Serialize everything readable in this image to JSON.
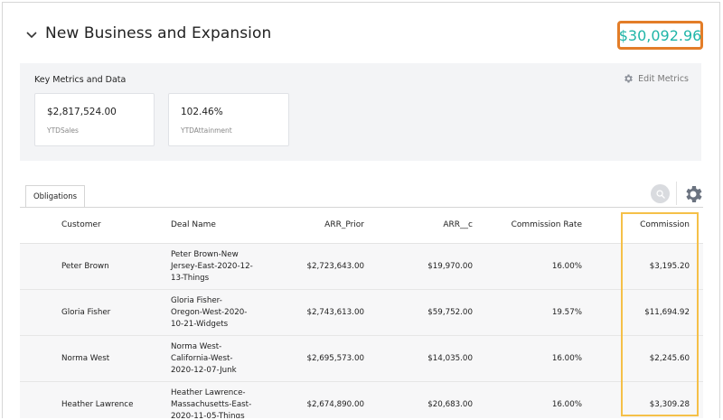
{
  "header": {
    "title": "New Business and Expansion",
    "amount": "$30,092.96"
  },
  "metrics": {
    "title": "Key Metrics and Data",
    "edit_label": "Edit Metrics",
    "cards": [
      {
        "value": "$2,817,524.00",
        "label": "YTDSales"
      },
      {
        "value": "102.46%",
        "label": "YTDAttainment"
      }
    ]
  },
  "tabs": [
    {
      "label": "Obligations"
    }
  ],
  "table": {
    "columns": [
      "Customer",
      "Deal Name",
      "ARR_Prior",
      "ARR__c",
      "Commission Rate",
      "Commission"
    ],
    "rows": [
      {
        "customer": "Peter Brown",
        "deal_lines": [
          "Peter Brown-New",
          "Jersey-East-2020-12-",
          "13-Things"
        ],
        "arr_prior": "$2,723,643.00",
        "arr_c": "$19,970.00",
        "rate": "16.00%",
        "commission": "$3,195.20"
      },
      {
        "customer": "Gloria Fisher",
        "deal_lines": [
          "Gloria Fisher-",
          "Oregon-West-2020-",
          "10-21-Widgets"
        ],
        "arr_prior": "$2,743,613.00",
        "arr_c": "$59,752.00",
        "rate": "19.57%",
        "commission": "$11,694.92"
      },
      {
        "customer": "Norma West",
        "deal_lines": [
          "Norma West-",
          "California-West-",
          "2020-12-07-Junk"
        ],
        "arr_prior": "$2,695,573.00",
        "arr_c": "$14,035.00",
        "rate": "16.00%",
        "commission": "$2,245.60"
      },
      {
        "customer": "Heather Lawrence",
        "deal_lines": [
          "Heather Lawrence-",
          "Massachusetts-East-",
          "2020-11-05-Things"
        ],
        "arr_prior": "$2,674,890.00",
        "arr_c": "$20,683.00",
        "rate": "16.00%",
        "commission": "$3,309.28"
      }
    ]
  },
  "colors": {
    "amount_text": "#1fb5a8",
    "amount_border": "#e37d28",
    "commission_highlight": "#f5c048",
    "metrics_bg": "#f3f4f6"
  },
  "icons": [
    "chevron-down-icon",
    "gear-icon",
    "search-icon",
    "settings-gear-icon"
  ]
}
